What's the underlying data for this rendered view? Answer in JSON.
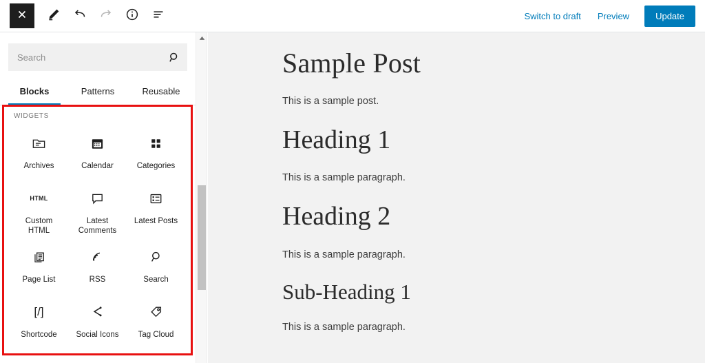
{
  "toolbar": {
    "left_buttons": [
      {
        "name": "close-editor-button",
        "icon": "close-icon",
        "label": "Close"
      },
      {
        "name": "edit-mode-button",
        "icon": "pencil-icon",
        "label": "Edit"
      },
      {
        "name": "undo-button",
        "icon": "undo-icon",
        "label": "Undo"
      },
      {
        "name": "redo-button",
        "icon": "redo-icon",
        "label": "Redo",
        "disabled": true
      },
      {
        "name": "details-button",
        "icon": "info-icon",
        "label": "Details"
      },
      {
        "name": "list-view-button",
        "icon": "list-view-icon",
        "label": "List view"
      }
    ],
    "switch_to_draft_label": "Switch to draft",
    "preview_label": "Preview",
    "update_label": "Update",
    "accent_color": "#007cba"
  },
  "inserter": {
    "search": {
      "placeholder": "Search",
      "value": "",
      "icon": "search-icon"
    },
    "tabs": [
      {
        "label": "Blocks",
        "active": true
      },
      {
        "label": "Patterns",
        "active": false
      },
      {
        "label": "Reusable",
        "active": false
      }
    ],
    "section_label": "WIDGETS",
    "highlight_color": "#e81010",
    "widgets": [
      {
        "label": "Archives",
        "icon": "archive-folder-icon"
      },
      {
        "label": "Calendar",
        "icon": "calendar-icon"
      },
      {
        "label": "Categories",
        "icon": "categories-grid-icon"
      },
      {
        "label": "Custom HTML",
        "icon": "html-icon"
      },
      {
        "label": "Latest Comments",
        "icon": "comment-bubble-icon"
      },
      {
        "label": "Latest Posts",
        "icon": "list-posts-icon"
      },
      {
        "label": "Page List",
        "icon": "pages-stack-icon"
      },
      {
        "label": "RSS",
        "icon": "rss-icon"
      },
      {
        "label": "Search",
        "icon": "search-icon"
      },
      {
        "label": "Shortcode",
        "icon": "shortcode-icon"
      },
      {
        "label": "Social Icons",
        "icon": "share-icon"
      },
      {
        "label": "Tag Cloud",
        "icon": "tag-icon"
      }
    ]
  },
  "scrollbar": {
    "up_arrow_icon": "chevron-up-icon",
    "thumb_name": "sidebar-scroll-thumb"
  },
  "canvas": {
    "title": "Sample Post",
    "blocks": [
      {
        "type": "paragraph",
        "text": "This is a sample post."
      },
      {
        "type": "heading1",
        "text": "Heading 1"
      },
      {
        "type": "paragraph",
        "text": "This is a sample paragraph."
      },
      {
        "type": "heading2",
        "text": "Heading 2"
      },
      {
        "type": "paragraph",
        "text": "This is a sample paragraph."
      },
      {
        "type": "subheading",
        "text": "Sub-Heading 1"
      },
      {
        "type": "paragraph",
        "text": "This is a sample paragraph."
      }
    ]
  }
}
